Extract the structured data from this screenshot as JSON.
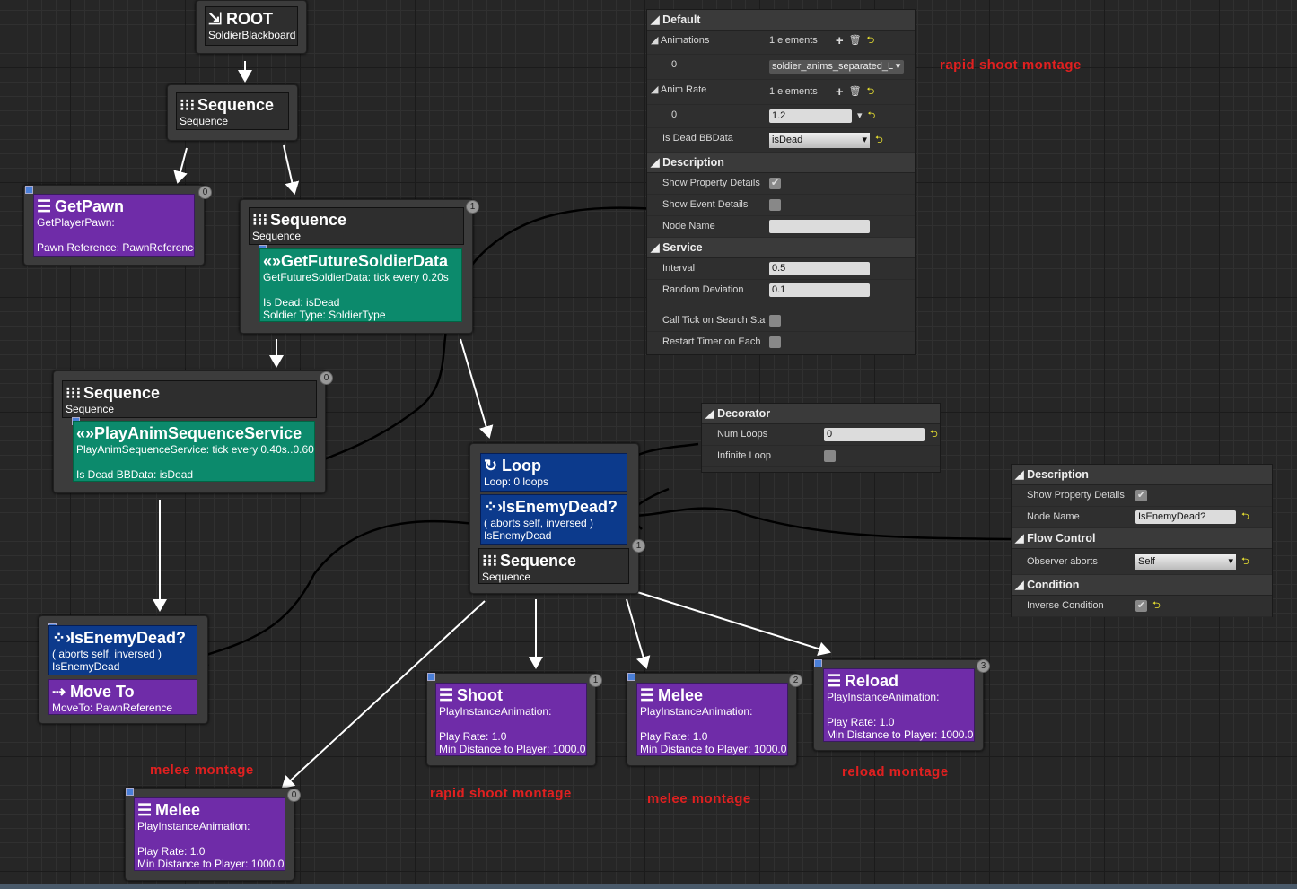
{
  "nodes": {
    "root": {
      "title": "ROOT",
      "sub": "SoldierBlackboard",
      "icon": "root-icon"
    },
    "seq1": {
      "title": "Sequence",
      "sub": "Sequence"
    },
    "getpawn": {
      "title": "GetPawn",
      "l1": "GetPlayerPawn:",
      "l2": "Pawn Reference: PawnReference",
      "badge": "0"
    },
    "seq2": {
      "title": "Sequence",
      "sub": "Sequence",
      "badge": "1",
      "svc_title": "GetFutureSoldierData",
      "svc_l1": "GetFutureSoldierData: tick every 0.20s",
      "svc_l2": "Is Dead: isDead",
      "svc_l3": "Soldier Type: SoldierType"
    },
    "seq3": {
      "title": "Sequence",
      "sub": "Sequence",
      "badge": "0",
      "svc_title": "PlayAnimSequenceService",
      "svc_l1": "PlayAnimSequenceService: tick every 0.40s..0.60s",
      "svc_l2": "Is Dead BBData: isDead"
    },
    "loopseq": {
      "loop_title": "Loop",
      "loop_sub": "Loop: 0 loops",
      "dec_title": "IsEnemyDead?",
      "dec_l1": "( aborts self, inversed )",
      "dec_l2": "IsEnemyDead",
      "title": "Sequence",
      "sub": "Sequence",
      "badge": "1"
    },
    "moveto": {
      "dec_title": "IsEnemyDead?",
      "dec_l1": "( aborts self, inversed )",
      "dec_l2": "IsEnemyDead",
      "title": "Move To",
      "sub": "MoveTo: PawnReference"
    },
    "shoot": {
      "title": "Shoot",
      "l1": "PlayInstanceAnimation:",
      "l2": "Play Rate: 1.0",
      "l3": "Min Distance to Player: 1000.0",
      "badge": "1"
    },
    "melee1": {
      "title": "Melee",
      "l1": "PlayInstanceAnimation:",
      "l2": "Play Rate: 1.0",
      "l3": "Min Distance to Player: 1000.0",
      "badge": "2"
    },
    "reload": {
      "title": "Reload",
      "l1": "PlayInstanceAnimation:",
      "l2": "Play Rate: 1.0",
      "l3": "Min Distance to Player: 1000.0",
      "badge": "3"
    },
    "melee2": {
      "title": "Melee",
      "l1": "PlayInstanceAnimation:",
      "l2": "Play Rate: 1.0",
      "l3": "Min Distance to Player: 1000.0",
      "badge": "0"
    }
  },
  "annotations": [
    "rapid shoot montage",
    "melee montage",
    "rapid shoot montage",
    "melee montage",
    "reload montage"
  ],
  "service_panel": {
    "default": "Default",
    "animations": "Animations",
    "animations_count": "1 elements",
    "anim_index": "0",
    "anim_value": "soldier_anims_separated_L",
    "anim_rate": "Anim Rate",
    "anim_rate_count": "1 elements",
    "rate_index": "0",
    "rate_value": "1.2",
    "is_dead": "Is Dead BBData",
    "is_dead_value": "isDead",
    "description": "Description",
    "show_prop": "Show Property Details",
    "show_prop_checked": true,
    "show_event": "Show Event Details",
    "show_event_checked": false,
    "node_name": "Node Name",
    "node_name_value": "",
    "service": "Service",
    "interval": "Interval",
    "interval_value": "0.5",
    "random_dev": "Random Deviation",
    "random_dev_value": "0.1",
    "call_tick": "Call Tick on Search Sta",
    "call_tick_checked": false,
    "restart_timer": "Restart Timer on Each",
    "restart_timer_checked": false
  },
  "decorator_panel": {
    "decorator": "Decorator",
    "num_loops": "Num Loops",
    "num_loops_value": "0",
    "infinite_loop": "Infinite Loop",
    "infinite_loop_checked": false
  },
  "condition_panel": {
    "description": "Description",
    "show_prop": "Show Property Details",
    "show_prop_checked": true,
    "node_name": "Node Name",
    "node_name_value": "IsEnemyDead?",
    "flow_control": "Flow Control",
    "observer_aborts": "Observer aborts",
    "observer_aborts_value": "Self",
    "condition": "Condition",
    "inverse": "Inverse Condition",
    "inverse_checked": true
  },
  "colors": {
    "task": "#6f2ca8",
    "service": "#0c8a6c",
    "decorator": "#0c3a8c",
    "annotation": "#e02020"
  }
}
